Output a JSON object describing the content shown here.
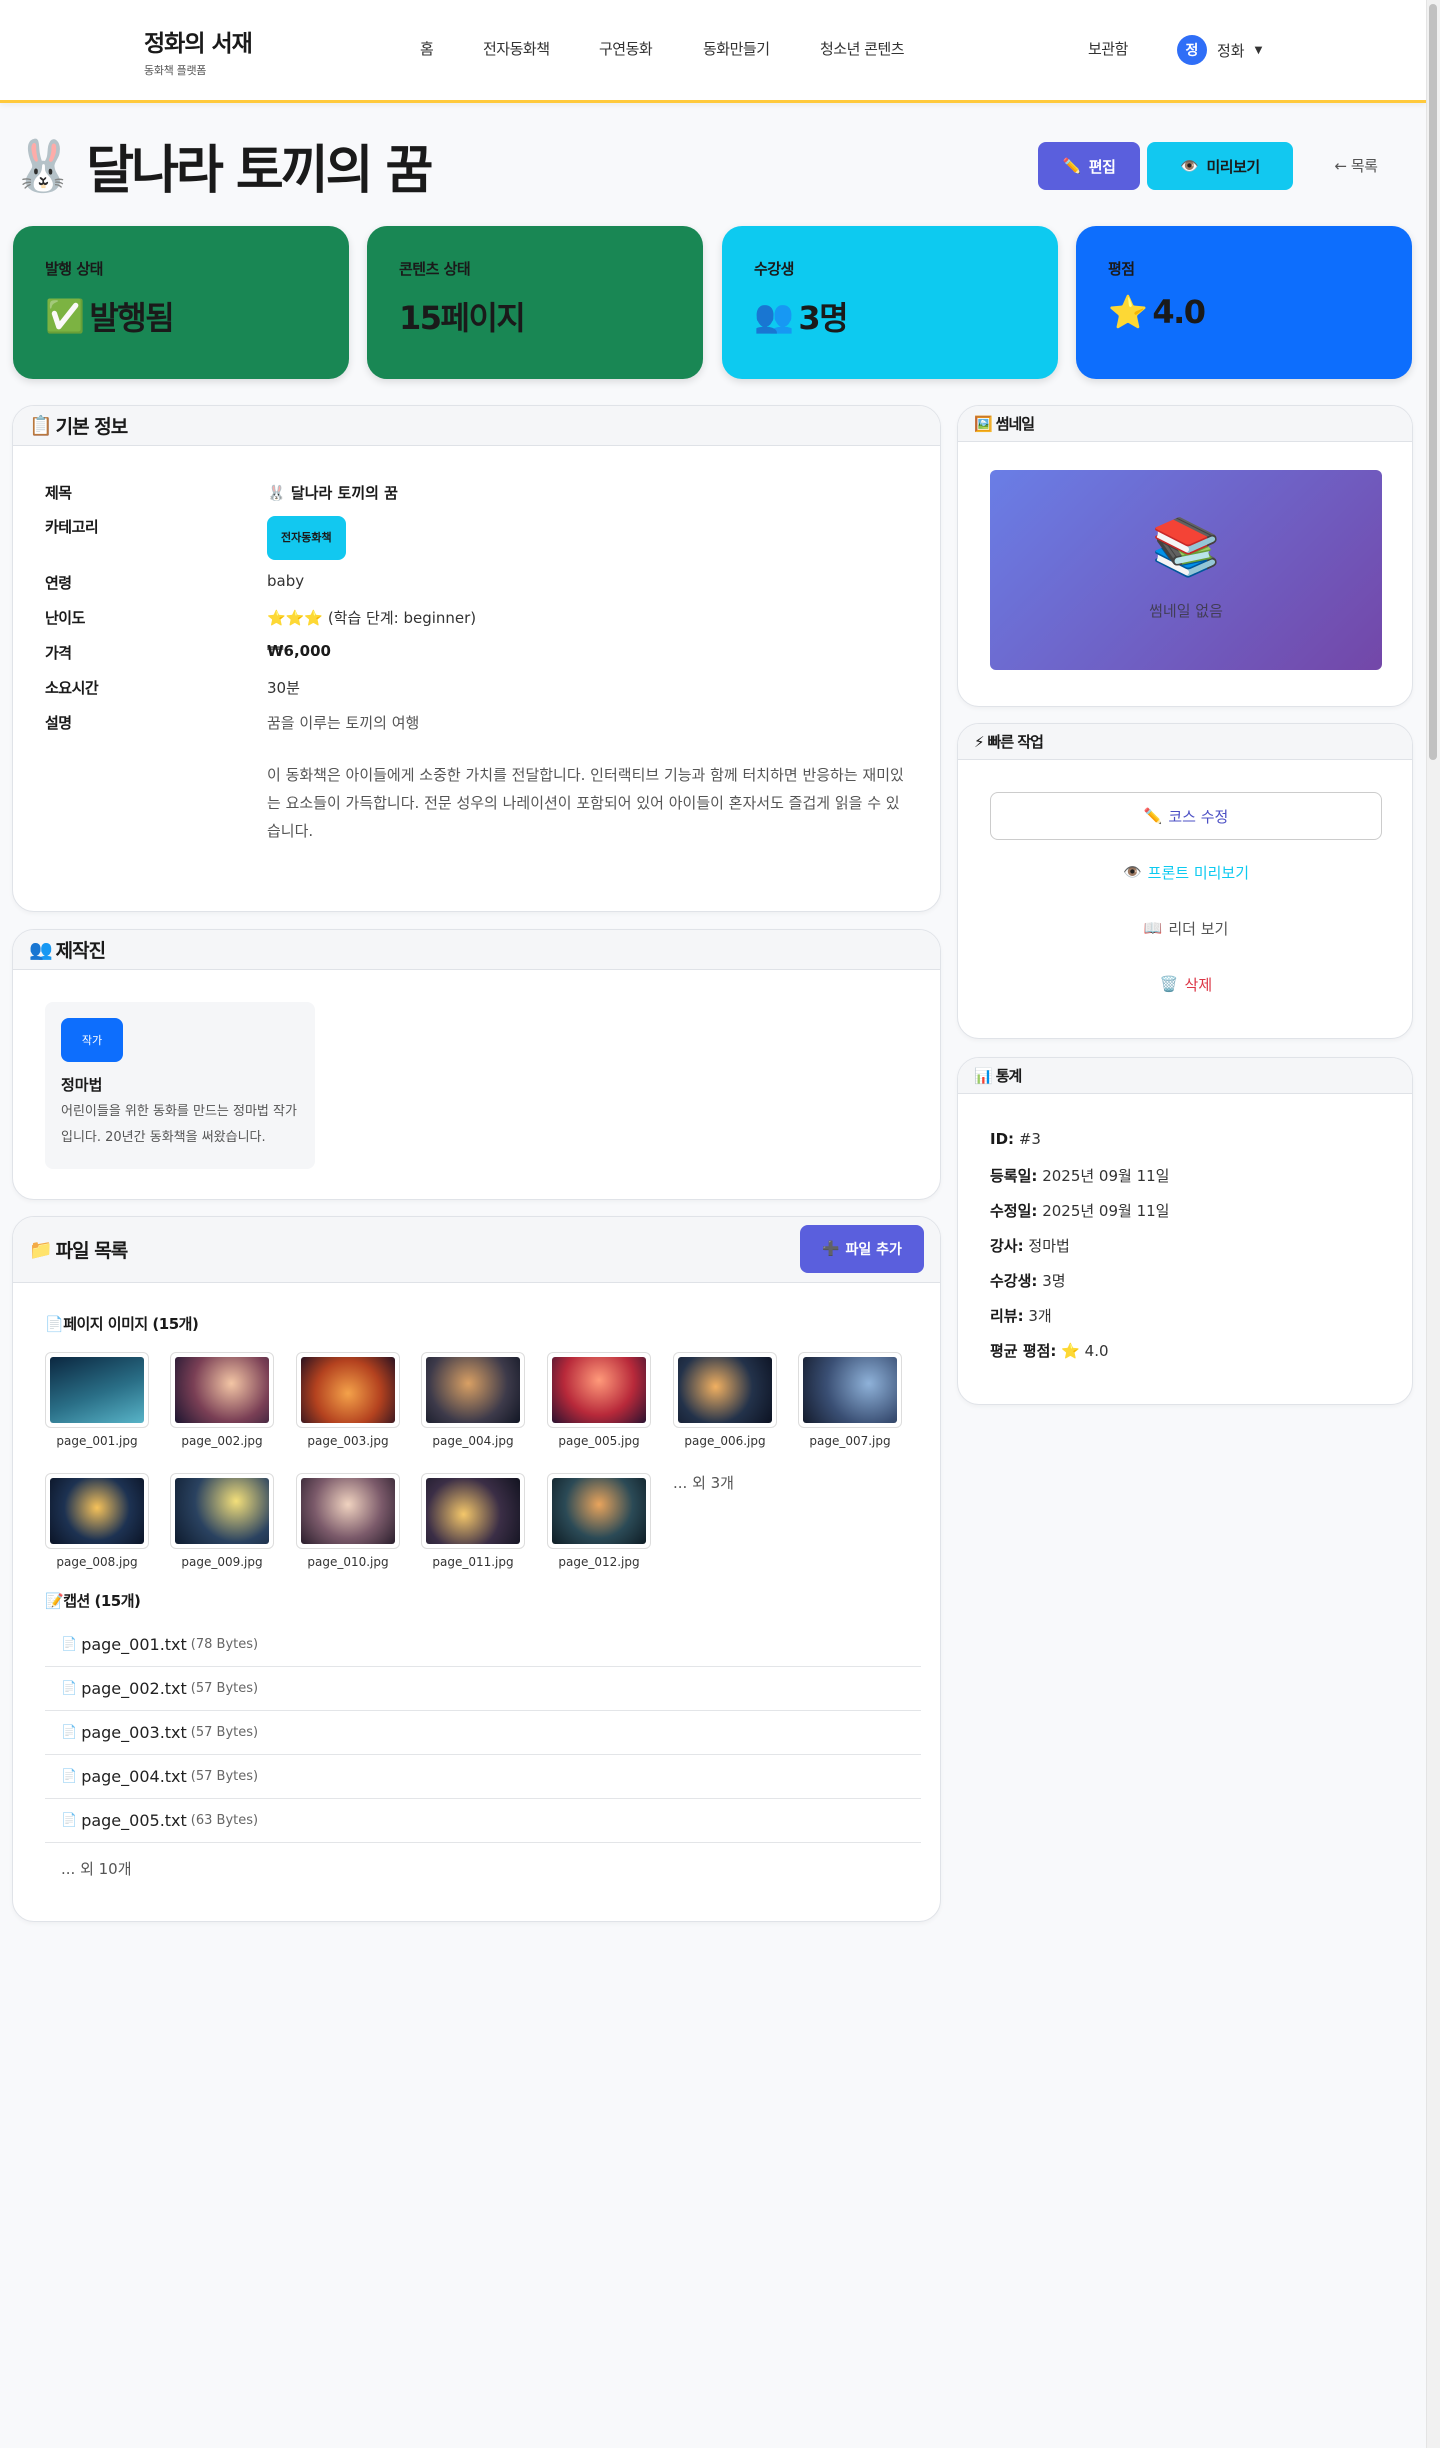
{
  "header": {
    "brand_title": "정화의 서재",
    "brand_sub": "동화책 플랫폼",
    "nav": [
      "홈",
      "전자동화책",
      "구연동화",
      "동화만들기",
      "청소년 콘텐츠"
    ],
    "vault": "보관함",
    "avatar_initial": "정",
    "user_name": "정화"
  },
  "page": {
    "title_icon": "🐰",
    "title": "달나라 토끼의 꿈",
    "edit_label": "편집",
    "preview_label": "미리보기",
    "list_label": "← 목록"
  },
  "stats": [
    {
      "label": "발행 상태",
      "icon": "✅",
      "value": "발행됨",
      "color": "#198754"
    },
    {
      "label": "콘텐츠 상태",
      "icon": "",
      "value": "15페이지",
      "color": "#198754"
    },
    {
      "label": "수강생",
      "icon": "👥",
      "value": "3명",
      "color": "#0dcaf0"
    },
    {
      "label": "평점",
      "icon": "⭐",
      "value": "4.0",
      "color": "#0d6efd"
    }
  ],
  "basic": {
    "heading": "기본 정보",
    "rows": {
      "title_k": "제목",
      "title_v": "🐰 달나라 토끼의 꿈",
      "cat_k": "카테고리",
      "cat_v": "전자동화책",
      "age_k": "연령",
      "age_v": "baby",
      "diff_k": "난이도",
      "diff_stars": "⭐⭐⭐",
      "diff_v": "(학습 단계: beginner)",
      "price_k": "가격",
      "price_v": "₩6,000",
      "time_k": "소요시간",
      "time_v": "30분",
      "desc_k": "설명",
      "desc_v1": "꿈을 이루는 토끼의 여행",
      "desc_v2": "이 동화책은 아이들에게 소중한 가치를 전달합니다. 인터랙티브 기능과 함께 터치하면 반응하는 재미있는 요소들이 가득합니다. 전문 성우의 나레이션이 포함되어 있어 아이들이 혼자서도 즐겁게 읽을 수 있습니다."
    }
  },
  "crew": {
    "heading": "제작진",
    "role": "작가",
    "name": "정마법",
    "bio": "어린이들을 위한 동화를 만드는 정마법 작가입니다. 20년간 동화책을 써왔습니다."
  },
  "files": {
    "heading": "파일 목록",
    "add_label": "파일 추가",
    "images_heading": "페이지 이미지 (15개)",
    "images": [
      "page_001.jpg",
      "page_002.jpg",
      "page_003.jpg",
      "page_004.jpg",
      "page_005.jpg",
      "page_006.jpg",
      "page_007.jpg",
      "page_008.jpg",
      "page_009.jpg",
      "page_010.jpg",
      "page_011.jpg",
      "page_012.jpg"
    ],
    "images_more": "... 외 3개",
    "captions_heading": "캡션 (15개)",
    "captions": [
      {
        "name": "page_001.txt",
        "size": "(78 Bytes)"
      },
      {
        "name": "page_002.txt",
        "size": "(57 Bytes)"
      },
      {
        "name": "page_003.txt",
        "size": "(57 Bytes)"
      },
      {
        "name": "page_004.txt",
        "size": "(57 Bytes)"
      },
      {
        "name": "page_005.txt",
        "size": "(63 Bytes)"
      }
    ],
    "captions_more": "... 외 10개"
  },
  "thumbnail": {
    "heading": "썸네일",
    "empty": "썸네일 없음"
  },
  "quick": {
    "heading": "빠른 작업",
    "edit": "코스 수정",
    "front": "프론트 미리보기",
    "reader": "리더 보기",
    "delete": "삭제"
  },
  "statistics": {
    "heading": "통계",
    "id_k": "ID:",
    "id_v": "#3",
    "reg_k": "등록일:",
    "reg_v": "2025년 09월 11일",
    "mod_k": "수정일:",
    "mod_v": "2025년 09월 11일",
    "inst_k": "강사:",
    "inst_v": "정마법",
    "stu_k": "수강생:",
    "stu_v": "3명",
    "rev_k": "리뷰:",
    "rev_v": "3개",
    "avg_k": "평균 평점:",
    "avg_v": "⭐ 4.0"
  }
}
